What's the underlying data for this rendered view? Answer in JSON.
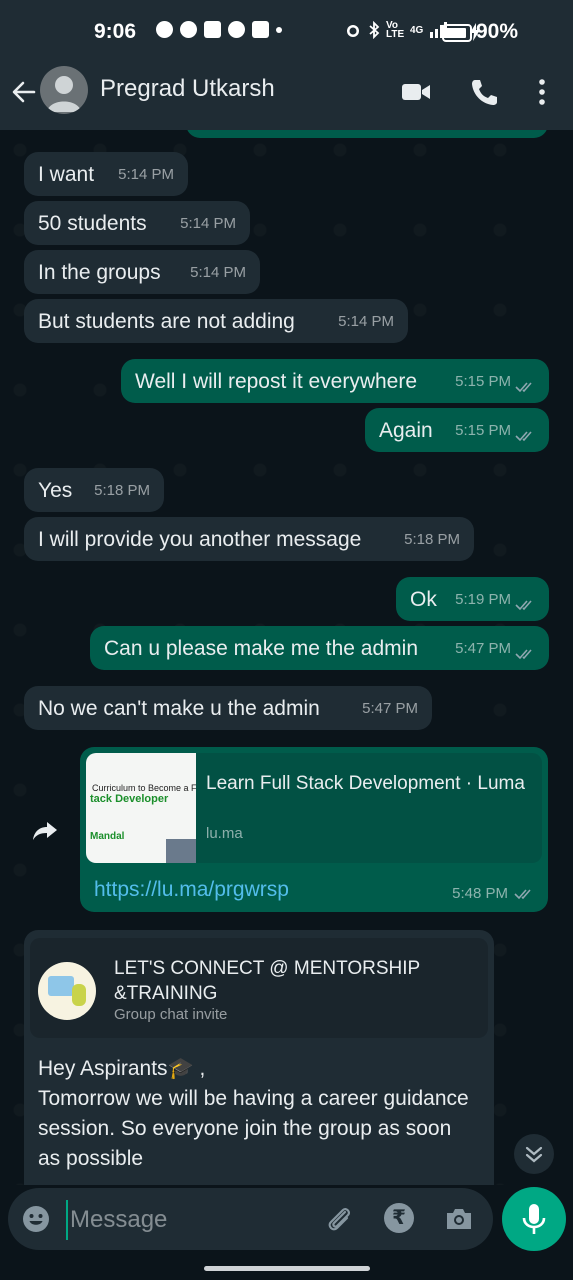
{
  "status_bar": {
    "time": "9:06",
    "battery": "90%",
    "network_label": "Vo LTE",
    "signal_label": "4G"
  },
  "header": {
    "contact_name": "Pregrad Utkarsh"
  },
  "messages": [
    {
      "dir": "in",
      "text": "I want",
      "time": "5:14 PM"
    },
    {
      "dir": "in",
      "text": "50 students",
      "time": "5:14 PM"
    },
    {
      "dir": "in",
      "text": "In the groups",
      "time": "5:14 PM"
    },
    {
      "dir": "in",
      "text": "But students are not adding",
      "time": "5:14 PM"
    },
    {
      "dir": "out",
      "text": "Well I will repost it everywhere",
      "time": "5:15 PM"
    },
    {
      "dir": "out",
      "text": "Again",
      "time": "5:15 PM"
    },
    {
      "dir": "in",
      "text": "Yes",
      "time": "5:18 PM"
    },
    {
      "dir": "in",
      "text": "I will provide you another message",
      "time": "5:18 PM"
    },
    {
      "dir": "out",
      "text": "Ok",
      "time": "5:19 PM"
    },
    {
      "dir": "out",
      "text": "Can u please make me the admin",
      "time": "5:47 PM"
    },
    {
      "dir": "in",
      "text": "No we can't make u the admin",
      "time": "5:47 PM"
    }
  ],
  "link_message": {
    "preview_title": "Learn Full Stack Development · Luma",
    "preview_domain": "lu.ma",
    "thumb_line1": "Curriculum to Become a Full Stack",
    "thumb_line2": "tack Developer",
    "thumb_line3": "Mandal",
    "url": "https://lu.ma/prgwrsp",
    "time": "5:48 PM"
  },
  "group_invite": {
    "group_name": "LET'S CONNECT @ MENTORSHIP &TRAINING",
    "subtitle": "Group chat invite",
    "body_line1": "Hey Aspirants🎓 ,",
    "body_line2": "Tomorrow we will be having a career guidance session. So everyone join the group as soon as possible"
  },
  "composer": {
    "placeholder": "Message"
  },
  "colors": {
    "incoming": "#1f2c34",
    "outgoing": "#005c4b",
    "accent": "#00a884",
    "link": "#53bdeb"
  }
}
